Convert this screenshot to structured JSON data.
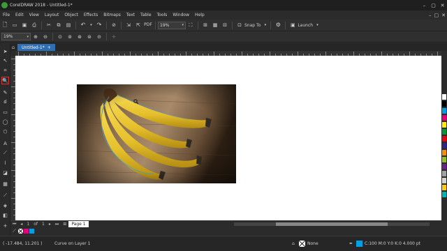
{
  "window": {
    "title": "CorelDRAW 2018 - Untitled-1*",
    "controls": [
      "–",
      "▢",
      "✕"
    ]
  },
  "menu": {
    "items": [
      "File",
      "Edit",
      "View",
      "Layout",
      "Object",
      "Effects",
      "Bitmaps",
      "Text",
      "Table",
      "Tools",
      "Window",
      "Help"
    ]
  },
  "standard_toolbar": {
    "zoom_value": "19%",
    "snap_label": "Snap To",
    "launch_label": "Launch"
  },
  "property_bar": {
    "zoom_value": "19%"
  },
  "document": {
    "tab_label": "Untitled-1*"
  },
  "page_nav": {
    "current": "1",
    "of_label": "of",
    "total": "1",
    "page_tab": "Page 1"
  },
  "status": {
    "coordinates": "( -17.484, 11.201 )",
    "selection": "Curve on Layer 1",
    "fill_label": "None",
    "outline_label": "C:100 M:0 Y:0 K:0  4.000 pt"
  },
  "colors": {
    "accent": "#2c6fb5",
    "canvas": "#ffffff",
    "ui_dark": "#2b2b2b",
    "palette": [
      "#ffffff",
      "#000000",
      "#00a0e3",
      "#e6007e",
      "#ffed00",
      "#009640",
      "#e30613",
      "#312783",
      "#f39200",
      "#95c11f",
      "#662483",
      "#a3a3a3",
      "#d3d3d3",
      "#ffcc00",
      "#00b4b4"
    ],
    "document_palette": [
      "#ffffff",
      "#e6007e",
      "#00a0e3"
    ]
  }
}
